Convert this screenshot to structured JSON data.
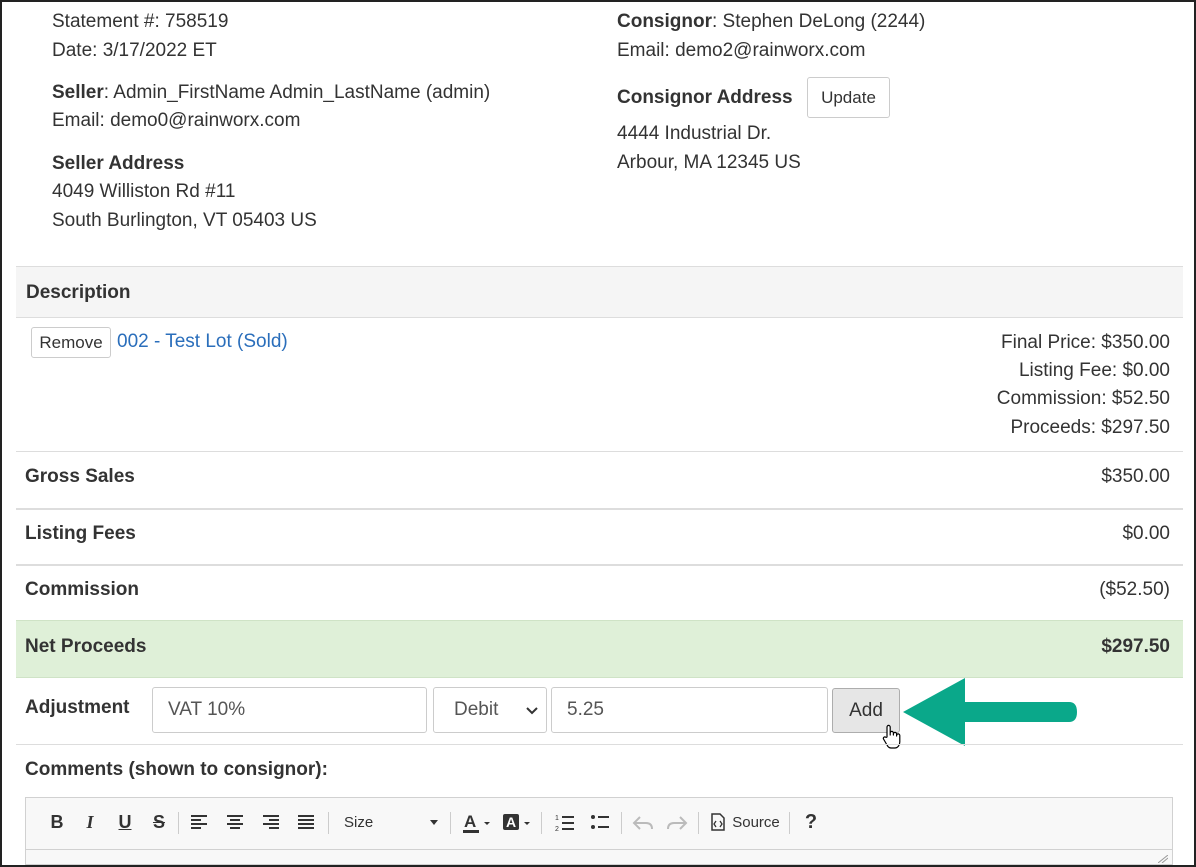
{
  "statement": {
    "number_line": "Statement #: 758519",
    "date_line": "Date: 3/17/2022 ET"
  },
  "seller": {
    "label": "Seller",
    "name": ": Admin_FirstName Admin_LastName (admin)",
    "email": "Email: demo0@rainworx.com",
    "address_label": "Seller Address",
    "address_line1": "4049 Williston Rd #11",
    "address_line2": "South Burlington, VT 05403 US"
  },
  "consignor": {
    "label": "Consignor",
    "name": ": Stephen DeLong (2244)",
    "email": "Email: demo2@rainworx.com",
    "address_label": "Consignor Address",
    "update_button": "Update",
    "address_line1": "4444 Industrial Dr.",
    "address_line2": "Arbour, MA 12345 US"
  },
  "table": {
    "header": "Description",
    "item": {
      "remove_button": "Remove",
      "link": "002 - Test Lot (Sold)",
      "final_price": "Final Price: $350.00",
      "listing_fee": "Listing Fee: $0.00",
      "commission": "Commission: $52.50",
      "proceeds": "Proceeds: $297.50"
    },
    "summary": [
      {
        "label": "Gross Sales",
        "value": "$350.00"
      },
      {
        "label": "Listing Fees",
        "value": "$0.00"
      },
      {
        "label": "Commission",
        "value": "($52.50)"
      }
    ],
    "net": {
      "label": "Net Proceeds",
      "value": "$297.50"
    }
  },
  "adjustment": {
    "label": "Adjustment",
    "description_value": "VAT 10%",
    "type_selected": "Debit",
    "amount_value": "5.25",
    "add_button": "Add"
  },
  "comments": {
    "label": "Comments (shown to consignor):",
    "toolbar": {
      "bold": "B",
      "italic": "I",
      "underline": "U",
      "strike": "S",
      "size_label": "Size",
      "source_label": "Source",
      "help": "?"
    }
  },
  "colors": {
    "net_row_bg": "#dff0d8",
    "header_bg": "#f5f5f5",
    "link": "#2a6ebb",
    "arrow": "#0aa88a"
  }
}
